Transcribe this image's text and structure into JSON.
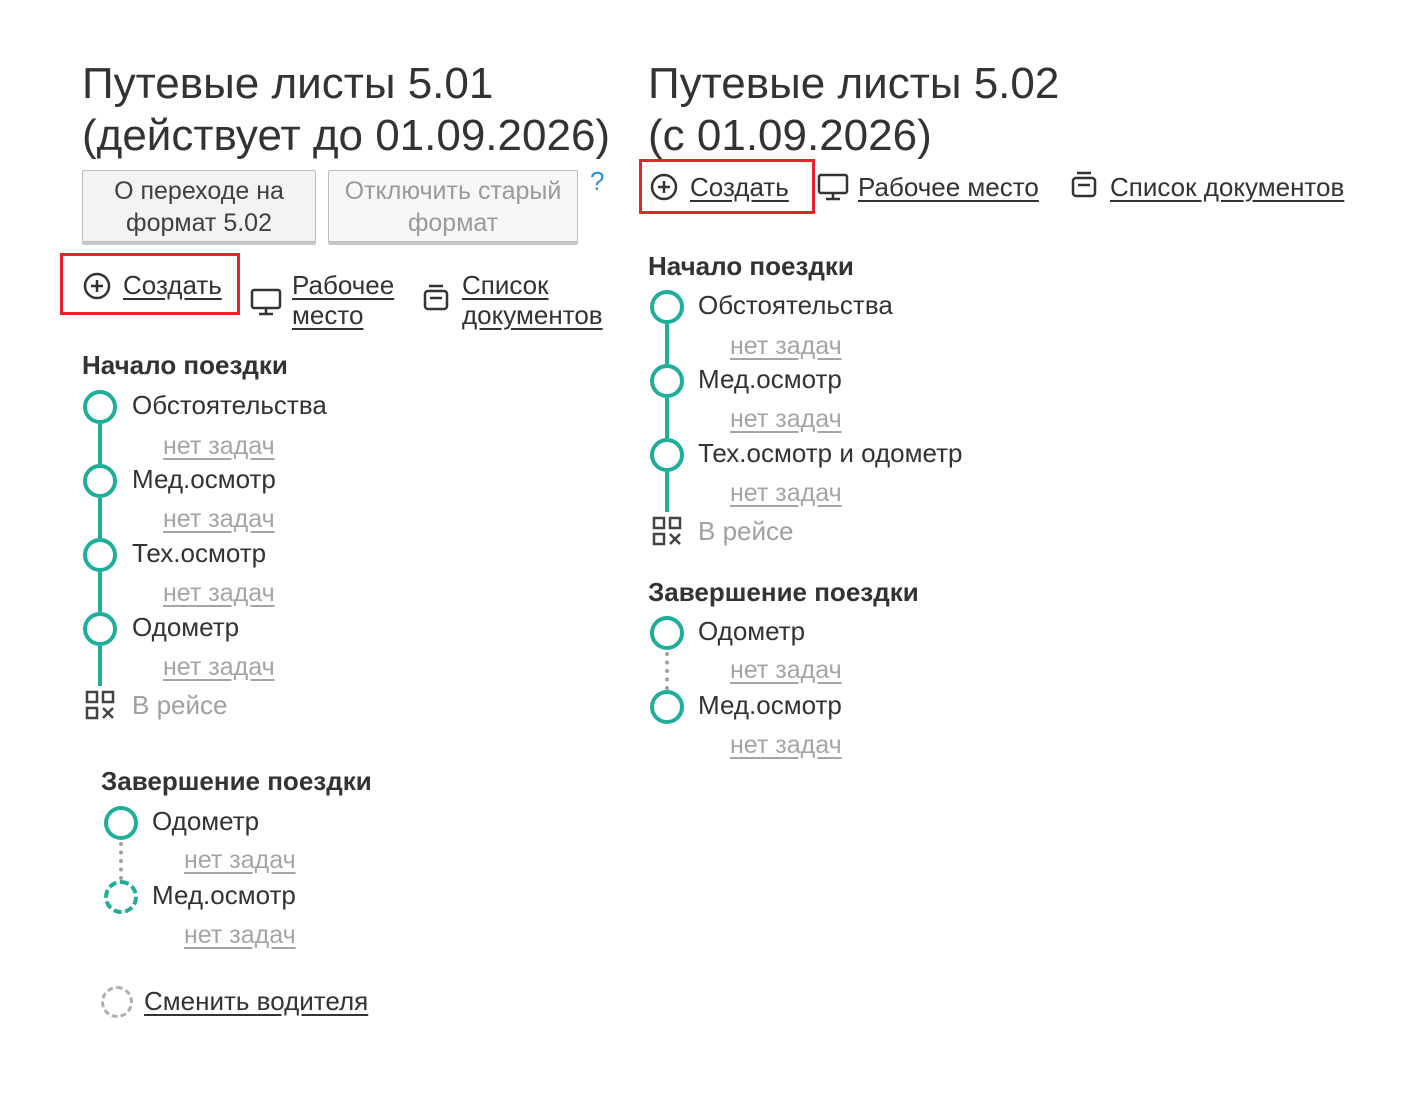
{
  "left": {
    "title_line1": "Путевые листы 5.01",
    "title_line2": "(действует до 01.09.2026)",
    "btn_transition": "О переходе на формат 5.02",
    "btn_disable": "Отключить старый формат",
    "help": "?",
    "create_label": "Создать",
    "workplace_label": "Рабочее место",
    "doclist_label": "Список документов",
    "start_section": "Начало поездки",
    "start_steps": [
      "Обстоятельства",
      "Мед.осмотр",
      "Тех.осмотр",
      "Одометр"
    ],
    "in_trip": "В рейсе",
    "end_section": "Завершение поездки",
    "end_steps": [
      "Одометр",
      "Мед.осмотр"
    ],
    "no_tasks": "нет задач",
    "change_driver": "Сменить водителя"
  },
  "right": {
    "title_line1": "Путевые листы 5.02",
    "title_line2": "(с 01.09.2026)",
    "create_label": "Создать",
    "workplace_label": "Рабочее место",
    "doclist_label": "Список документов",
    "start_section": "Начало поездки",
    "start_steps": [
      "Обстоятельства",
      "Мед.осмотр",
      "Тех.осмотр и одометр"
    ],
    "in_trip": "В рейсе",
    "end_section": "Завершение поездки",
    "end_steps": [
      "Одометр",
      "Мед.осмотр"
    ],
    "no_tasks": "нет задач"
  },
  "colors": {
    "accent": "#1fae9a",
    "highlight": "#e8232a",
    "help": "#2f8fd6",
    "muted": "#a5a5a5"
  },
  "icons": {
    "create": "plus-circle-icon",
    "workplace": "monitor-icon",
    "doclist": "printer-icon",
    "in_trip": "qr-code-icon",
    "step": "circle-icon"
  }
}
